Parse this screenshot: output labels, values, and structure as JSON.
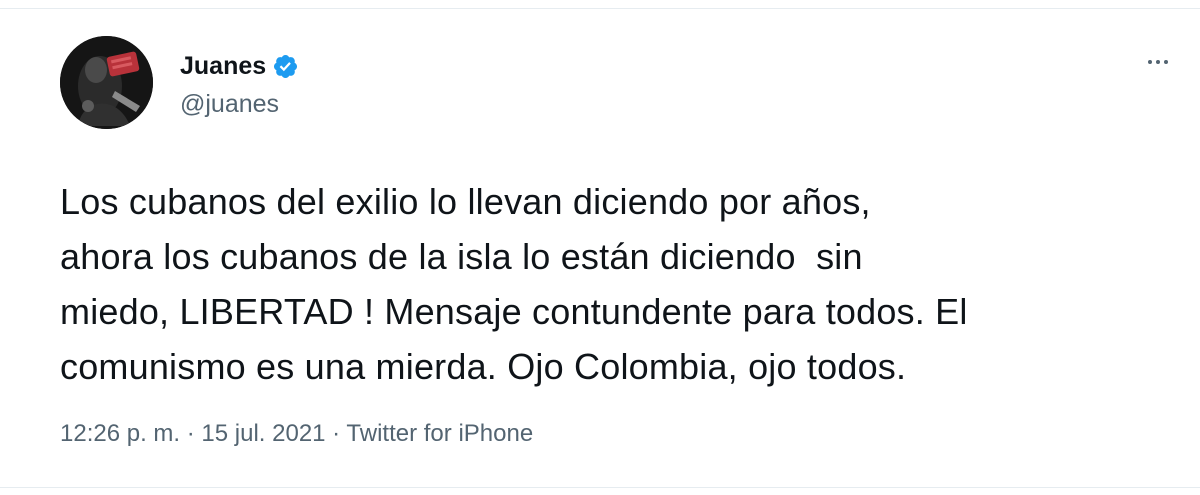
{
  "tweet": {
    "display_name": "Juanes",
    "handle": "@juanes",
    "text_lines": [
      "Los cubanos del exilio lo llevan diciendo por años,",
      "ahora los cubanos de la isla lo están diciendo  sin",
      "miedo, LIBERTAD ! Mensaje contundente para todos. El",
      "comunismo es una mierda. Ojo Colombia, ojo todos."
    ],
    "time": "12:26 p. m.",
    "separator": " · ",
    "date": "15 jul. 2021",
    "source": "Twitter for iPhone"
  },
  "icons": {
    "verified": "verified-badge-icon",
    "more": "more-options-icon"
  },
  "colors": {
    "verified_blue": "#1d9bf0",
    "text": "#0f1419",
    "secondary": "#536471",
    "divider": "#e6ecf0"
  }
}
